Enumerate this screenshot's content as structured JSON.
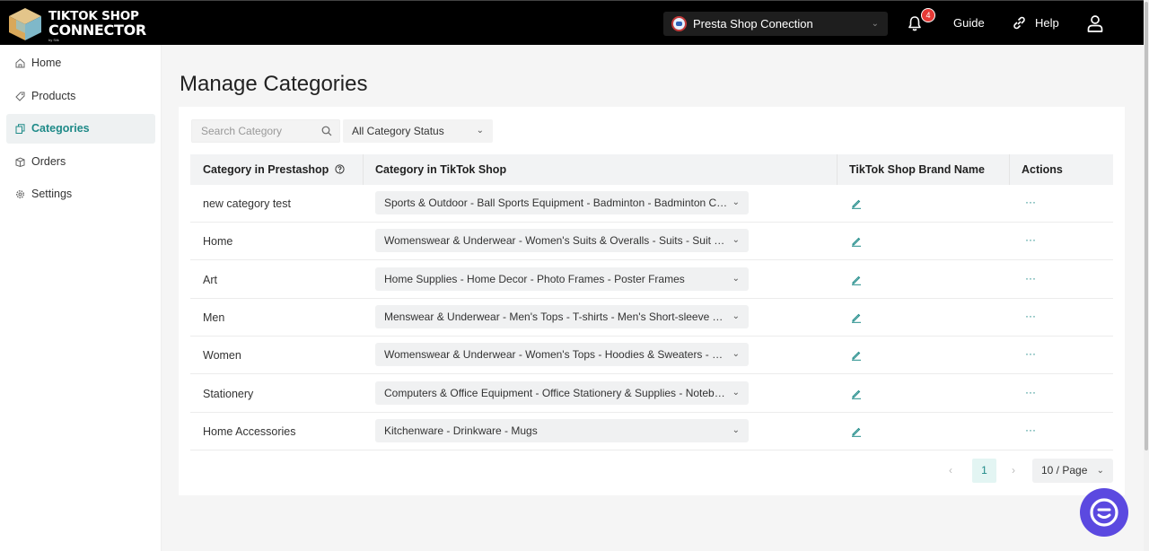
{
  "header": {
    "logo_line1": "TIKTOK SHOP",
    "logo_line2": "CONNECTOR",
    "logo_by": "by Silk",
    "shop_selector": "Presta Shop Conection",
    "notification_count": "4",
    "guide_label": "Guide",
    "help_label": "Help"
  },
  "sidebar": {
    "items": [
      {
        "label": "Home",
        "icon": "home-icon"
      },
      {
        "label": "Products",
        "icon": "tag-icon"
      },
      {
        "label": "Categories",
        "icon": "copy-icon",
        "active": true
      },
      {
        "label": "Orders",
        "icon": "box-icon"
      },
      {
        "label": "Settings",
        "icon": "gear-icon"
      }
    ]
  },
  "main": {
    "title": "Manage Categories",
    "search_placeholder": "Search Category",
    "status_filter": "All Category Status",
    "columns": [
      "Category in Prestashop",
      "Category in TikTok Shop",
      "TikTok Shop Brand Name",
      "Actions"
    ],
    "rows": [
      {
        "prestashop": "new category test",
        "tiktok": "Sports & Outdoor - Ball Sports Equipment - Badminton - Badminton Co..."
      },
      {
        "prestashop": "Home",
        "tiktok": "Womenswear & Underwear - Women's Suits & Overalls - Suits - Suit Sep..."
      },
      {
        "prestashop": "Art",
        "tiktok": "Home Supplies - Home Decor - Photo Frames - Poster Frames"
      },
      {
        "prestashop": "Men",
        "tiktok": "Menswear & Underwear - Men's Tops - T-shirts - Men's Short-sleeve T-s..."
      },
      {
        "prestashop": "Women",
        "tiktok": "Womenswear & Underwear - Women's Tops - Hoodies & Sweaters - Wo..."
      },
      {
        "prestashop": "Stationery",
        "tiktok": "Computers & Office Equipment - Office Stationery & Supplies - Noteboo..."
      },
      {
        "prestashop": "Home Accessories",
        "tiktok": "Kitchenware - Drinkware - Mugs"
      }
    ],
    "pagination": {
      "current_page": "1",
      "page_size": "10  / Page"
    }
  },
  "colors": {
    "accent": "#1e8a88",
    "header_bg": "#000000",
    "chat_fab": "#5b49e0"
  }
}
